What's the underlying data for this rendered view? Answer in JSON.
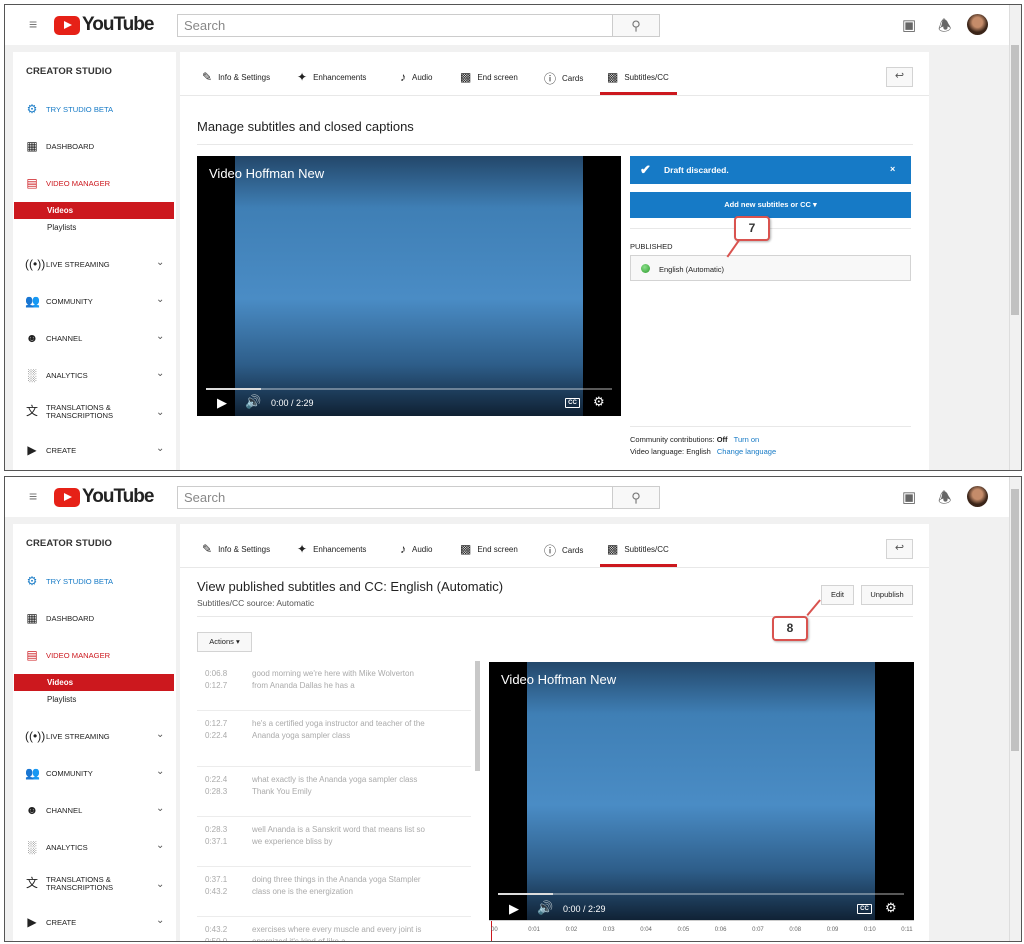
{
  "header": {
    "logo_text": "YouTube",
    "search_placeholder": "Search"
  },
  "sidebar": {
    "title": "CREATOR STUDIO",
    "try_beta": "TRY STUDIO BETA",
    "dashboard": "DASHBOARD",
    "video_manager": "VIDEO MANAGER",
    "videos": "Videos",
    "playlists": "Playlists",
    "live_streaming": "LIVE STREAMING",
    "community": "COMMUNITY",
    "channel": "CHANNEL",
    "analytics": "ANALYTICS",
    "translations_1": "TRANSLATIONS &",
    "translations_2": "TRANSCRIPTIONS",
    "create": "CREATE"
  },
  "tabs": {
    "info": "Info & Settings",
    "enhancements": "Enhancements",
    "audio": "Audio",
    "end_screen": "End screen",
    "cards": "Cards",
    "subtitles": "Subtitles/CC"
  },
  "panel1": {
    "heading": "Manage subtitles and closed captions",
    "video_title": "Video Hoffman New",
    "time": "0:00 / 2:29",
    "notice": "Draft discarded.",
    "close": "×",
    "add_button": "Add new subtitles or CC ▾",
    "published_label": "PUBLISHED",
    "language": "English (Automatic)",
    "community_label": "Community contributions:",
    "community_value": "Off",
    "turn_on": "Turn on",
    "video_lang_label": "Video language:",
    "video_lang_value": "English",
    "change_language": "Change language",
    "callout": "7"
  },
  "panel2": {
    "heading": "View published subtitles and CC: English (Automatic)",
    "source": "Subtitles/CC source: Automatic",
    "edit": "Edit",
    "unpublish": "Unpublish",
    "actions": "Actions ▾",
    "video_title": "Video Hoffman New",
    "time": "0:00 / 2:29",
    "callout": "8",
    "captions": [
      {
        "start": "0:06.8",
        "end": "0:12.7",
        "text": "good morning we're here with Mike Wolverton from Ananda Dallas he has a"
      },
      {
        "start": "0:12.7",
        "end": "0:22.4",
        "text": "he's a certified yoga instructor and teacher of the Ananda yoga sampler class"
      },
      {
        "start": "0:22.4",
        "end": "0:28.3",
        "text": "what exactly is the Ananda yoga sampler class Thank You Emily"
      },
      {
        "start": "0:28.3",
        "end": "0:37.1",
        "text": "well Ananda is a Sanskrit word that means list so we experience bliss by"
      },
      {
        "start": "0:37.1",
        "end": "0:43.2",
        "text": "doing three things in the Ananda yoga Stampler class one is the energization"
      },
      {
        "start": "0:43.2",
        "end": "0:50.0",
        "text": "exercises where every muscle and every joint is energized it's kind of like a"
      }
    ],
    "timeline": [
      "00",
      "0:01",
      "0:02",
      "0:03",
      "0:04",
      "0:05",
      "0:06",
      "0:07",
      "0:08",
      "0:09",
      "0:10",
      "0:11"
    ]
  }
}
